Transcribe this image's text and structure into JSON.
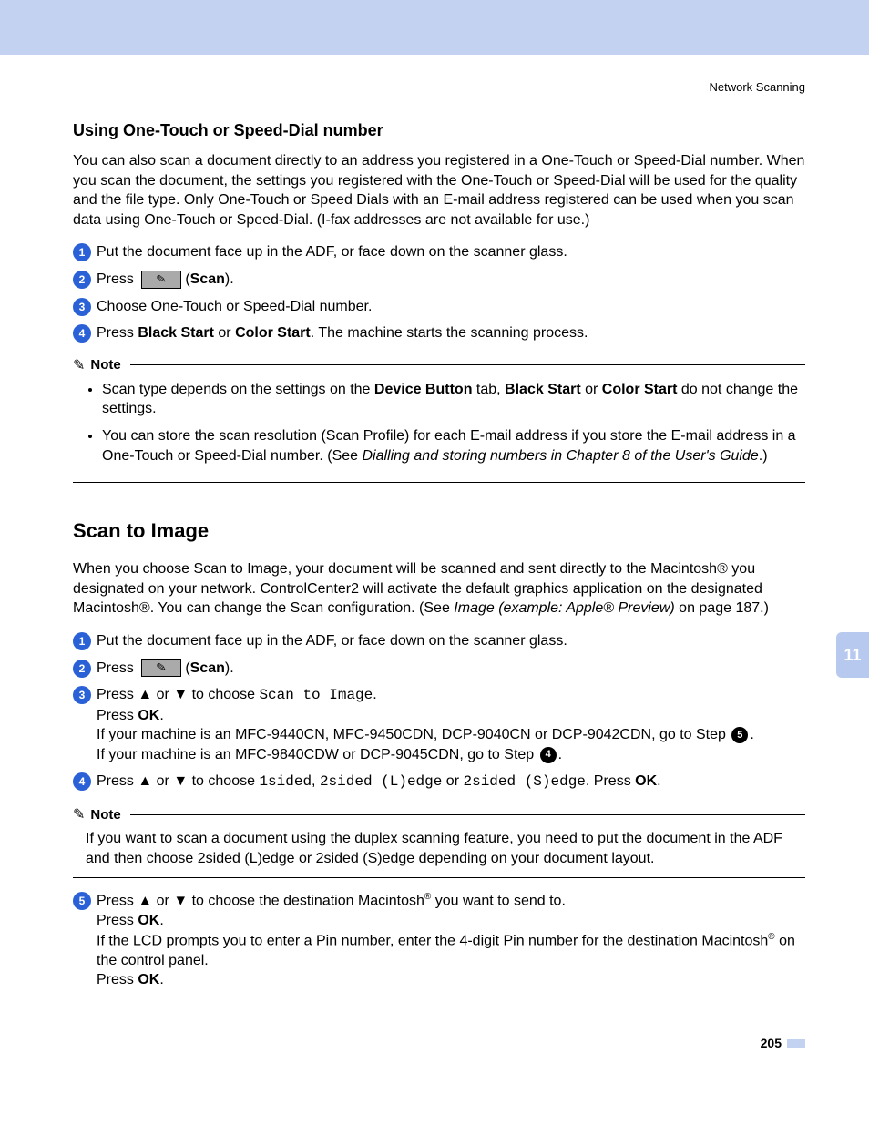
{
  "running_head": "Network Scanning",
  "s1": {
    "title": "Using One-Touch or Speed-Dial number",
    "intro": "You can also scan a document directly to an address you registered in a One-Touch or Speed-Dial number. When you scan the document, the settings you registered with the One-Touch or Speed-Dial will be used for the quality and the file type. Only One-Touch or Speed Dials with an E-mail address registered can be used when you scan data using One-Touch or Speed-Dial. (I-fax addresses are not available for use.)",
    "step1": "Put the document face up in the ADF, or face down on the scanner glass.",
    "step2_pre": "Press ",
    "step2_scan": "Scan",
    "step3": "Choose One-Touch or Speed-Dial number.",
    "step4_pre": "Press ",
    "step4_b1": "Black Start",
    "step4_mid": " or ",
    "step4_b2": "Color Start",
    "step4_post": ". The machine starts the scanning process.",
    "note_label": "Note",
    "note1_a": "Scan type depends on the settings on the ",
    "note1_b1": "Device Button",
    "note1_b": " tab, ",
    "note1_b2": "Black Start",
    "note1_c": " or ",
    "note1_b3": "Color Start",
    "note1_d": " do not change the settings.",
    "note2_a": "You can store the scan resolution (Scan Profile) for each E-mail address if you store the E-mail address in a One-Touch or Speed-Dial number. (See ",
    "note2_i": "Dialling and storing numbers in Chapter 8 of the User's Guide",
    "note2_b": ".)"
  },
  "s2": {
    "title": "Scan to Image",
    "intro_a": "When you choose Scan to Image, your document will be scanned and sent directly to the Macintosh",
    "intro_b": " you designated on your network. ControlCenter2 will activate the default graphics application on the designated Macintosh",
    "intro_c": ". You can change the Scan configuration. (See ",
    "intro_i": "Image (example: Apple",
    "intro_i2": " Preview)",
    "intro_d": " on page 187.)",
    "step1": "Put the document face up in the ADF, or face down on the scanner glass.",
    "step2_pre": "Press ",
    "step2_scan": "Scan",
    "step3_a": "Press ",
    "step3_up": "▲",
    "step3_mid1": " or ",
    "step3_down": "▼",
    "step3_b": " to choose ",
    "step3_mono": "Scan to Image",
    "step3_c": ".",
    "step3_press": "Press ",
    "step3_ok": "OK",
    "step3_d": "If your machine is an MFC-9440CN, MFC-9450CDN, DCP-9040CN or DCP-9042CDN, go to Step ",
    "step3_ref5": "5",
    "step3_e": "If your machine is an MFC-9840CDW or DCP-9045CDN, go to Step ",
    "step3_ref4": "4",
    "step4_a": "Press ",
    "step4_b": " to choose ",
    "step4_m1": "1sided",
    "step4_c": ", ",
    "step4_m2": "2sided (L)edge",
    "step4_d": " or ",
    "step4_m3": "2sided (S)edge",
    "step4_e": ". Press ",
    "step4_ok": "OK",
    "note2_label": "Note",
    "note2_a": "If you want to scan a document using the duplex scanning feature, you need to put the document in the ADF and then choose ",
    "note2_m1": "2sided (L)edge",
    "note2_b": " or ",
    "note2_m2": "2sided (S)edge",
    "note2_c": " depending on your document layout.",
    "step5_a": "Press ",
    "step5_b": " to choose the destination Macintosh",
    "step5_c": " you want to send to.",
    "step5_press": "Press ",
    "step5_ok": "OK",
    "step5_d": "If the LCD prompts you to enter a Pin number, enter the 4-digit Pin number for the destination Macintosh",
    "step5_e": " on the control panel."
  },
  "side_tab": "11",
  "page_number": "205"
}
